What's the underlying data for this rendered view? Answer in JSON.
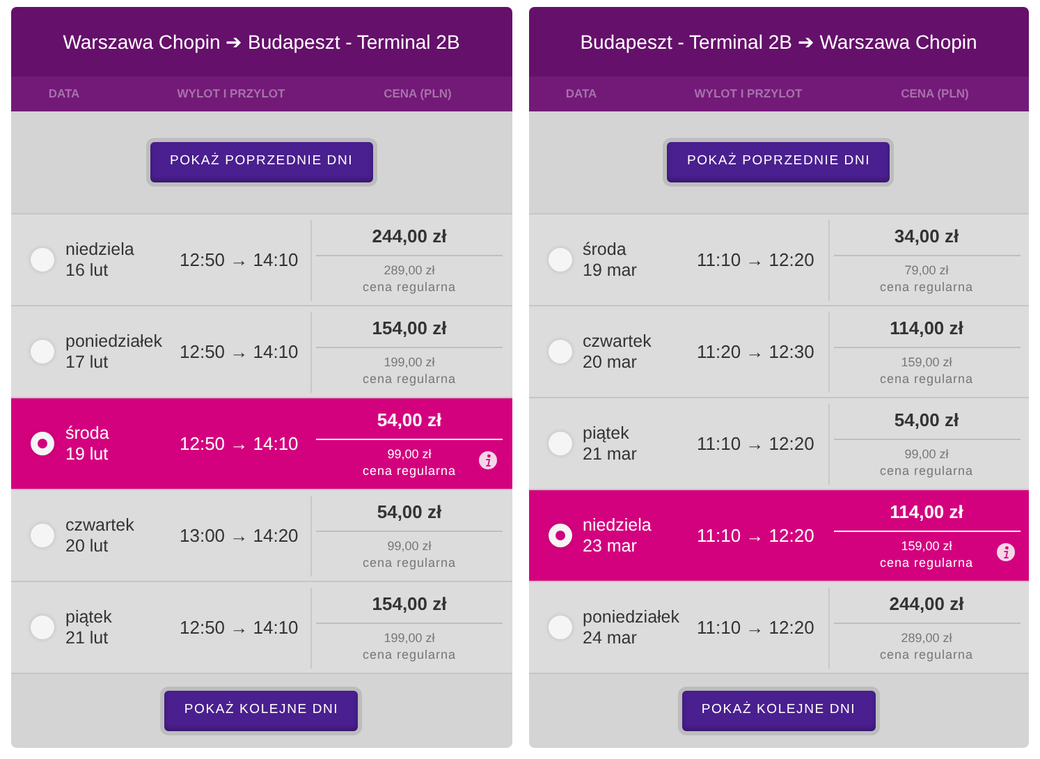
{
  "panels": [
    {
      "title": "Warszawa Chopin ➔ Budapeszt - Terminal 2B",
      "columns": [
        "DATA",
        "WYLOT I PRZYLOT",
        "CENA (PLN)"
      ],
      "prev_button": "POKAŻ POPRZEDNIE DNI",
      "next_button": "POKAŻ KOLEJNE DNI",
      "flights": [
        {
          "day": "niedziela",
          "date": "16 lut",
          "time": "12:50 → 14:10",
          "price": "244,00 zł",
          "regular_price": "289,00 zł",
          "regular_label": "cena regularna",
          "selected": false
        },
        {
          "day": "poniedziałek",
          "date": "17 lut",
          "time": "12:50 → 14:10",
          "price": "154,00 zł",
          "regular_price": "199,00 zł",
          "regular_label": "cena regularna",
          "selected": false
        },
        {
          "day": "środa",
          "date": "19 lut",
          "time": "12:50 → 14:10",
          "price": "54,00 zł",
          "regular_price": "99,00 zł",
          "regular_label": "cena regularna",
          "selected": true
        },
        {
          "day": "czwartek",
          "date": "20 lut",
          "time": "13:00 → 14:20",
          "price": "54,00 zł",
          "regular_price": "99,00 zł",
          "regular_label": "cena regularna",
          "selected": false
        },
        {
          "day": "piątek",
          "date": "21 lut",
          "time": "12:50 → 14:10",
          "price": "154,00 zł",
          "regular_price": "199,00 zł",
          "regular_label": "cena regularna",
          "selected": false
        }
      ]
    },
    {
      "title": "Budapeszt - Terminal 2B ➔ Warszawa Chopin",
      "columns": [
        "DATA",
        "WYLOT I PRZYLOT",
        "CENA (PLN)"
      ],
      "prev_button": "POKAŻ POPRZEDNIE DNI",
      "next_button": "POKAŻ KOLEJNE DNI",
      "flights": [
        {
          "day": "środa",
          "date": "19 mar",
          "time": "11:10 → 12:20",
          "price": "34,00 zł",
          "regular_price": "79,00 zł",
          "regular_label": "cena regularna",
          "selected": false
        },
        {
          "day": "czwartek",
          "date": "20 mar",
          "time": "11:20 → 12:30",
          "price": "114,00 zł",
          "regular_price": "159,00 zł",
          "regular_label": "cena regularna",
          "selected": false
        },
        {
          "day": "piątek",
          "date": "21 mar",
          "time": "11:10 → 12:20",
          "price": "54,00 zł",
          "regular_price": "99,00 zł",
          "regular_label": "cena regularna",
          "selected": false
        },
        {
          "day": "niedziela",
          "date": "23 mar",
          "time": "11:10 → 12:20",
          "price": "114,00 zł",
          "regular_price": "159,00 zł",
          "regular_label": "cena regularna",
          "selected": true
        },
        {
          "day": "poniedziałek",
          "date": "24 mar",
          "time": "11:10 → 12:20",
          "price": "244,00 zł",
          "regular_price": "289,00 zł",
          "regular_label": "cena regularna",
          "selected": false
        }
      ]
    }
  ]
}
